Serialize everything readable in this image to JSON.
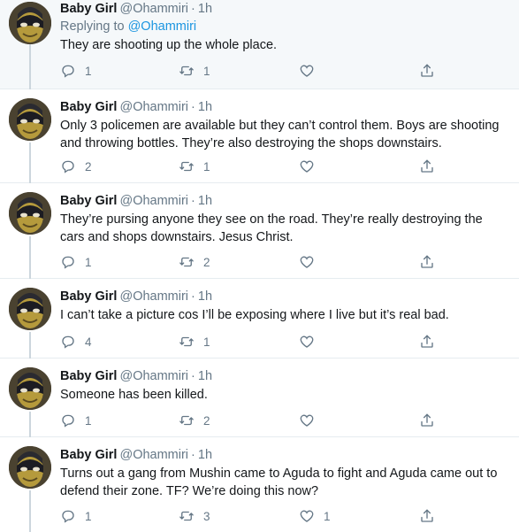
{
  "colors": {
    "text": "#14171a",
    "muted": "#657786",
    "link": "#1b95e0",
    "highlight_bg": "#f5f8fa",
    "divider": "#e6ecf0"
  },
  "icons": {
    "reply": "reply-icon",
    "retweet": "retweet-icon",
    "like": "heart-icon",
    "share": "share-icon"
  },
  "tweets": [
    {
      "name": "Baby Girl",
      "handle": "@Ohammiri",
      "dot": "·",
      "time": "1h",
      "replying_label": "Replying to",
      "replying_to": "@Ohammiri",
      "text": "They are shooting up the whole place.",
      "replies": "1",
      "retweets": "1",
      "likes": ""
    },
    {
      "name": "Baby Girl",
      "handle": "@Ohammiri",
      "dot": "·",
      "time": "1h",
      "text": "Only 3 policemen are available but they can’t control them. Boys are shooting and throwing bottles. They’re also destroying the shops downstairs.",
      "replies": "2",
      "retweets": "1",
      "likes": ""
    },
    {
      "name": "Baby Girl",
      "handle": "@Ohammiri",
      "dot": "·",
      "time": "1h",
      "text": "They’re pursing anyone they see on the road. They’re really destroying the cars and shops downstairs. Jesus Christ.",
      "replies": "1",
      "retweets": "2",
      "likes": ""
    },
    {
      "name": "Baby Girl",
      "handle": "@Ohammiri",
      "dot": "·",
      "time": "1h",
      "text": "I can’t take a picture cos I’ll be exposing where I live but it’s real bad.",
      "replies": "4",
      "retweets": "1",
      "likes": ""
    },
    {
      "name": "Baby Girl",
      "handle": "@Ohammiri",
      "dot": "·",
      "time": "1h",
      "text": "Someone has been killed.",
      "replies": "1",
      "retweets": "2",
      "likes": ""
    },
    {
      "name": "Baby Girl",
      "handle": "@Ohammiri",
      "dot": "·",
      "time": "1h",
      "text": "Turns out a gang from Mushin came to Aguda to fight and Aguda came out to defend their zone. TF? We’re doing this now?",
      "replies": "1",
      "retweets": "3",
      "likes": "1"
    }
  ]
}
